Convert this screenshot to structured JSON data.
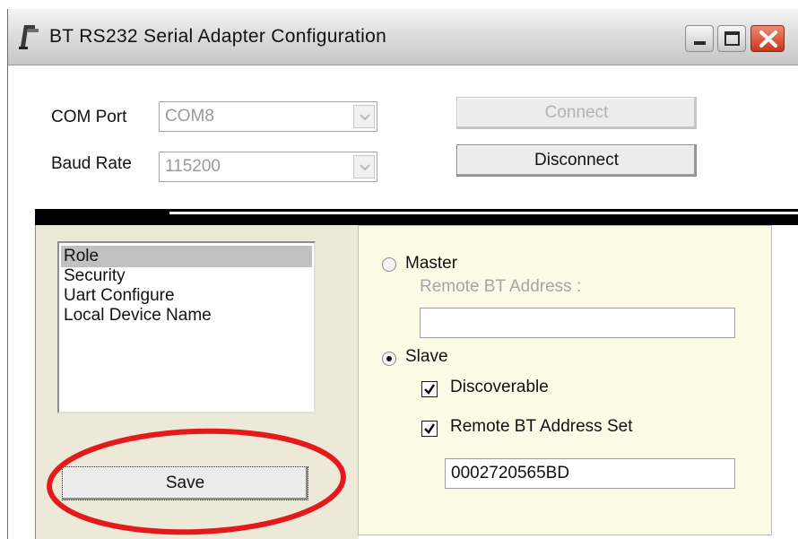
{
  "window": {
    "title": "BT RS232 Serial Adapter Configuration",
    "icons": {
      "app": "bluetooth-plug-icon",
      "minimize": "minimize-icon",
      "maximize": "maximize-icon",
      "close": "close-icon"
    }
  },
  "connection": {
    "com_port_label": "COM Port",
    "com_port_value": "COM8",
    "baud_rate_label": "Baud Rate",
    "baud_rate_value": "115200",
    "connect_label": "Connect",
    "disconnect_label": "Disconnect"
  },
  "settings_list": {
    "items": [
      "Role",
      "Security",
      "Uart Configure",
      "Local Device Name"
    ],
    "selected": "Role"
  },
  "role": {
    "master_label": "Master",
    "remote_bt_address_label": "Remote BT Address :",
    "remote_bt_address_value": "",
    "slave_label": "Slave",
    "slave_selected": true,
    "discoverable_label": "Discoverable",
    "discoverable_checked": true,
    "remote_bt_address_set_label": "Remote BT Address Set",
    "remote_bt_address_set_checked": true,
    "remote_bt_address_set_value": "0002720565BD"
  },
  "actions": {
    "save_label": "Save"
  },
  "colors": {
    "annotation_ellipse": "#e41a1a",
    "right_panel_bg": "#fcfbe6"
  }
}
